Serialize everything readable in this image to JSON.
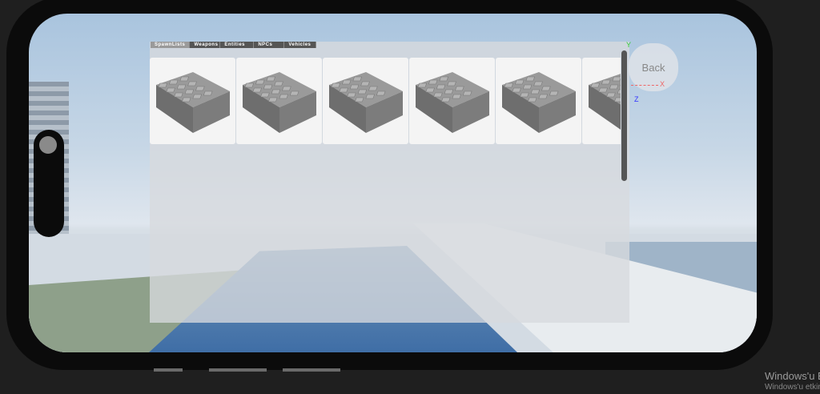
{
  "tabs": [
    {
      "label": "SpawnLists",
      "active": true
    },
    {
      "label": "Weapons"
    },
    {
      "label": "Entities"
    },
    {
      "label": "NPCs"
    },
    {
      "label": "Vehicles"
    }
  ],
  "items": [
    {
      "icon": "brick-icon"
    },
    {
      "icon": "brick-icon"
    },
    {
      "icon": "brick-icon"
    },
    {
      "icon": "brick-icon"
    },
    {
      "icon": "brick-icon"
    },
    {
      "icon": "brick-icon"
    }
  ],
  "back_label": "Back",
  "axes": {
    "x": "X",
    "y": "Y",
    "z": "Z"
  },
  "watermark": {
    "line1": "Windows'u E",
    "line2": "Windows'u etkin"
  }
}
